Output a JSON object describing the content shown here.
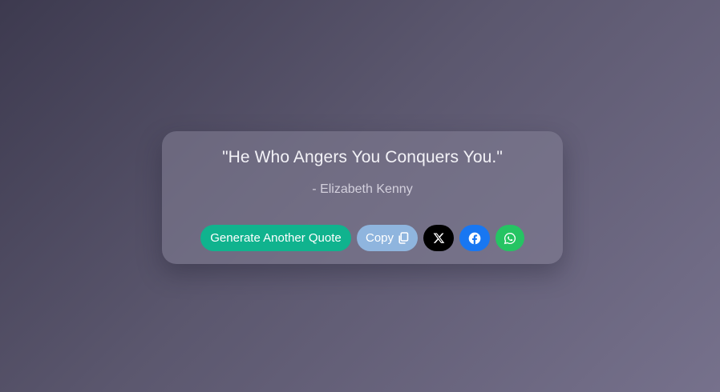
{
  "quote": {
    "text": "\"He Who Angers You Conquers You.\"",
    "author": "- Elizabeth Kenny"
  },
  "actions": {
    "generate_label": "Generate Another Quote",
    "copy_label": "Copy",
    "icons": {
      "copy": "copy-icon",
      "x": "x-icon",
      "facebook": "facebook-icon",
      "whatsapp": "whatsapp-icon"
    }
  },
  "colors": {
    "generate_button": "#10b38e",
    "copy_button": "#8fb5de",
    "x_button": "#000000",
    "facebook_button": "#1877f2",
    "whatsapp_button": "#25c463"
  }
}
